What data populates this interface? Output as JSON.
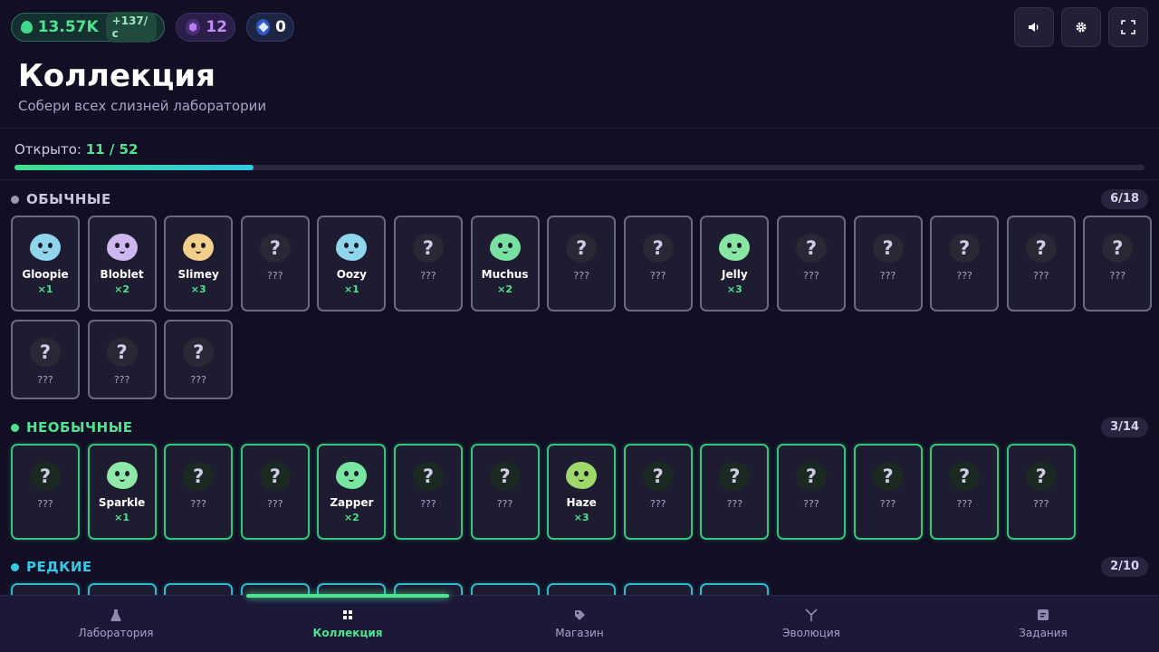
{
  "currencies": {
    "money": {
      "value": "13.57K",
      "rate": "+137/с",
      "icon": "slime-drop-icon",
      "color": "#4ee38e"
    },
    "gems": {
      "value": "12",
      "icon": "hexagon-gem-icon",
      "color": "#c48cf6"
    },
    "crystals": {
      "value": "0",
      "icon": "diamond-icon",
      "color": "#ffffff"
    }
  },
  "toolbar": {
    "sound_icon": "speaker-icon",
    "settings_icon": "gear-icon",
    "fullscreen_icon": "fullscreen-icon"
  },
  "header": {
    "title": "Коллекция",
    "subtitle": "Собери всех слизней лаборатории"
  },
  "progress": {
    "label": "Открыто:",
    "value": "11 / 52",
    "fraction": 0.2115
  },
  "sections": [
    {
      "key": "common",
      "title": "ОБЫЧНЫЕ",
      "count": "6/18",
      "color": "#8a88a0",
      "cards": [
        {
          "name": "Gloopie",
          "count": "×1",
          "color": "#8fd6ec",
          "unlocked": true
        },
        {
          "name": "Bloblet",
          "count": "×2",
          "color": "#cdb7ee",
          "unlocked": true
        },
        {
          "name": "Slimey",
          "count": "×3",
          "color": "#f2cf8a",
          "unlocked": true
        },
        {
          "name": "???",
          "count": "",
          "unlocked": false
        },
        {
          "name": "Oozy",
          "count": "×1",
          "color": "#8fd6ec",
          "unlocked": true
        },
        {
          "name": "???",
          "count": "",
          "unlocked": false
        },
        {
          "name": "Muchus",
          "count": "×2",
          "color": "#78e0a0",
          "unlocked": true
        },
        {
          "name": "???",
          "count": "",
          "unlocked": false
        },
        {
          "name": "???",
          "count": "",
          "unlocked": false
        },
        {
          "name": "Jelly",
          "count": "×3",
          "color": "#86e6a2",
          "unlocked": true
        },
        {
          "name": "???",
          "count": "",
          "unlocked": false
        },
        {
          "name": "???",
          "count": "",
          "unlocked": false
        },
        {
          "name": "???",
          "count": "",
          "unlocked": false
        },
        {
          "name": "???",
          "count": "",
          "unlocked": false
        },
        {
          "name": "???",
          "count": "",
          "unlocked": false
        },
        {
          "name": "???",
          "count": "",
          "unlocked": false
        },
        {
          "name": "???",
          "count": "",
          "unlocked": false
        },
        {
          "name": "???",
          "count": "",
          "unlocked": false
        }
      ]
    },
    {
      "key": "uncommon",
      "title": "НЕОБЫЧНЫЕ",
      "count": "3/14",
      "color": "#4ee38e",
      "cards": [
        {
          "name": "???",
          "count": "",
          "unlocked": false
        },
        {
          "name": "Sparkle",
          "count": "×1",
          "color": "#8ee8a8",
          "unlocked": true
        },
        {
          "name": "???",
          "count": "",
          "unlocked": false
        },
        {
          "name": "???",
          "count": "",
          "unlocked": false
        },
        {
          "name": "Zapper",
          "count": "×2",
          "color": "#78e6a0",
          "unlocked": true
        },
        {
          "name": "???",
          "count": "",
          "unlocked": false
        },
        {
          "name": "???",
          "count": "",
          "unlocked": false
        },
        {
          "name": "Haze",
          "count": "×3",
          "color": "#9ed86a",
          "unlocked": true
        },
        {
          "name": "???",
          "count": "",
          "unlocked": false
        },
        {
          "name": "???",
          "count": "",
          "unlocked": false
        },
        {
          "name": "???",
          "count": "",
          "unlocked": false
        },
        {
          "name": "???",
          "count": "",
          "unlocked": false
        },
        {
          "name": "???",
          "count": "",
          "unlocked": false
        },
        {
          "name": "???",
          "count": "",
          "unlocked": false
        }
      ]
    },
    {
      "key": "rare",
      "title": "РЕДКИЕ",
      "count": "2/10",
      "color": "#33c9e6",
      "cards": []
    }
  ],
  "nav": {
    "items": [
      {
        "label": "Лаборатория",
        "icon": "flask-icon",
        "active": false
      },
      {
        "label": "Коллекция",
        "icon": "grid-icon",
        "active": true
      },
      {
        "label": "Магазин",
        "icon": "tag-icon",
        "active": false
      },
      {
        "label": "Эволюция",
        "icon": "branch-icon",
        "active": false
      },
      {
        "label": "Задания",
        "icon": "task-list-icon",
        "active": false
      }
    ]
  }
}
